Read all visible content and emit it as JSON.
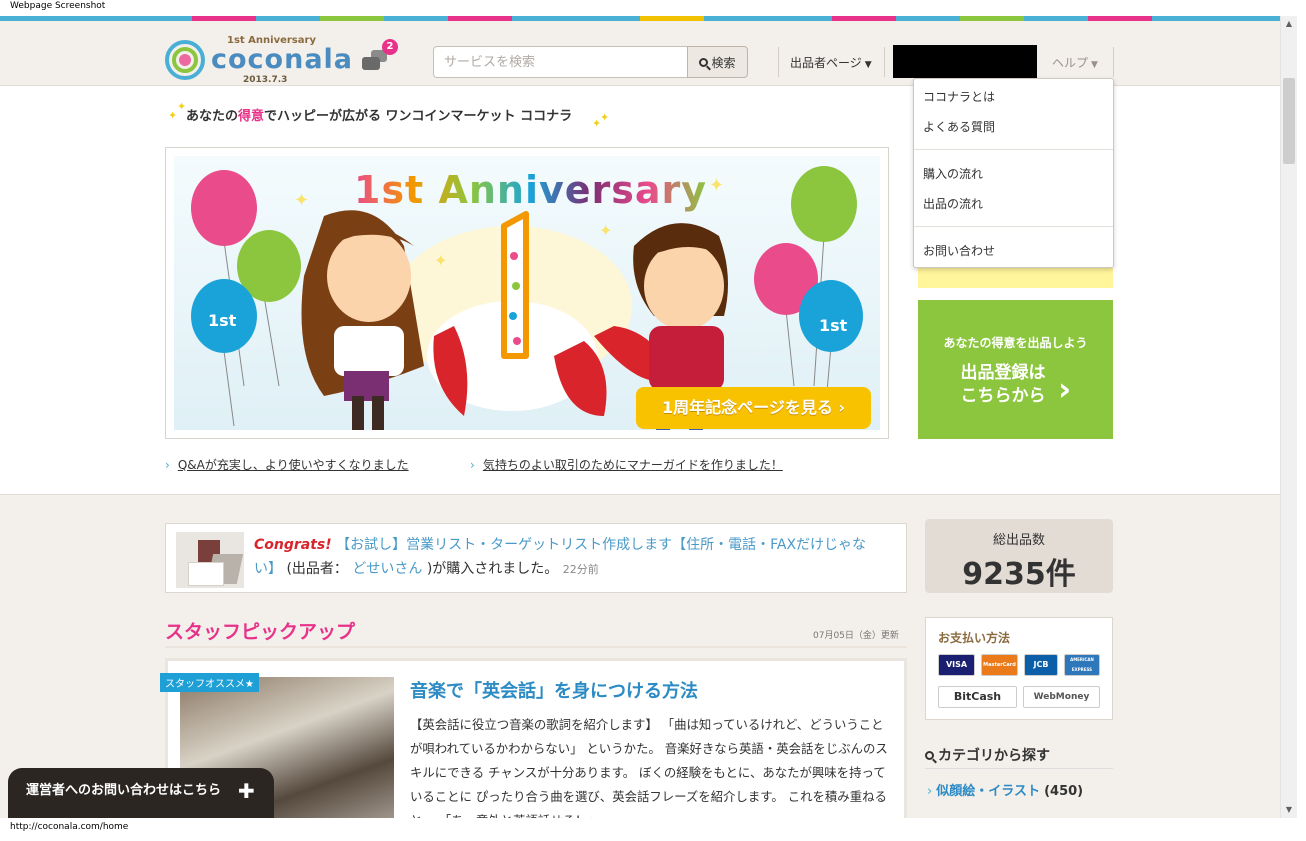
{
  "window": {
    "title": "Webpage Screenshot",
    "status_url": "http://coconala.com/home"
  },
  "colors": {
    "brand_blue": "#4aafd5",
    "brand_pink": "#e8328a",
    "brand_green": "#8cc63f",
    "brand_yellow": "#f9c200",
    "header_bg": "#f3efeb"
  },
  "colorbar": [
    "#4aafd5",
    "#4aafd5",
    "#4aafd5",
    "#e8328a",
    "#4aafd5",
    "#8cc63f",
    "#4aafd5",
    "#e8328a",
    "#4aafd5",
    "#4aafd5",
    "#f2c200",
    "#4aafd5",
    "#4aafd5",
    "#e8328a",
    "#4aafd5",
    "#8cc63f",
    "#4aafd5",
    "#e8328a",
    "#4aafd5",
    "#4aafd5"
  ],
  "header": {
    "logo": {
      "anniversary": "1st Anniversary",
      "word": "coconala",
      "date": "2013.7.3"
    },
    "messages_badge": "2",
    "search": {
      "placeholder": "サービスを検索",
      "value": "",
      "button": "検索"
    },
    "seller_menu": "出品者ページ",
    "help_menu": "ヘルプ",
    "caret": "▼"
  },
  "help_dropdown": {
    "items": [
      "ココナラとは",
      "よくある質問",
      "購入の流れ",
      "出品の流れ",
      "お問い合わせ"
    ]
  },
  "catchphrase": {
    "before": "あなたの",
    "highlight": "得意",
    "after": "でハッピーが広がる ワンコインマーケット ココナラ"
  },
  "banner": {
    "title": "1st Anniversary",
    "big_number": "1",
    "balloon_label": "1st",
    "cta": "1周年記念ページを見る ›"
  },
  "banner_links": [
    {
      "arrow": "›",
      "text": "Q&Aが充実し、より使いやすくなりました"
    },
    {
      "arrow": "›",
      "text": "気持ちのよい取引のためにマナーガイドを作りました！"
    }
  ],
  "side_cta": {
    "sub": "あなたの得意を出品しよう",
    "main_line1": "出品登録は",
    "main_line2": "こちらから",
    "chevron": "›"
  },
  "congrats": {
    "label": "Congrats!",
    "service": "【お試し】営業リスト・ターゲットリスト作成します【住所・電話・FAXだけじゃない】",
    "seller_prefix": "(出品者：",
    "seller": "どせいさん",
    "suffix": ")が購入されました。",
    "ago": "22分前"
  },
  "total_listings": {
    "label": "総出品数",
    "value": "9235件"
  },
  "staff_pickup": {
    "title": "スタッフピックアップ",
    "updated": "07月05日（金）更新",
    "article": {
      "tag": "スタッフオススメ★",
      "title": "音楽で「英会話」を身につける方法",
      "body": "【英会話に役立つ音楽の歌詞を紹介します】 「曲は知っているけれど、どういうことが唄われているかわからない」 というかた。 音楽好きなら英語・英会話をじぶんのスキルにできる チャンスが十分あります。 ぼくの経験をもとに、あなたが興味を持っていることに ぴったり合う曲を選び、英会話フレーズを紹介します。 これを積み重ねると… 「あ、意外と英語話せる！」"
    }
  },
  "payment": {
    "title": "お支払い方法",
    "cards": [
      {
        "label": "VISA",
        "color": "#1a1f71"
      },
      {
        "label": "MasterCard",
        "color": "#eb7a1a"
      },
      {
        "label": "JCB",
        "color": "#0b5fa8"
      },
      {
        "label": "AMERICAN EXPRESS",
        "color": "#2e77bb"
      },
      {
        "label": "BitCash",
        "color": "#ffffff"
      },
      {
        "label": "WebMoney",
        "color": "#ffffff"
      }
    ]
  },
  "categories": {
    "title": "カテゴリから探す",
    "items": [
      {
        "arrow": "›",
        "name": "似顔絵・イラスト",
        "count": "(450)"
      }
    ]
  },
  "contact_float": {
    "label": "運営者へのお問い合わせはこちら",
    "plus": "✚"
  }
}
